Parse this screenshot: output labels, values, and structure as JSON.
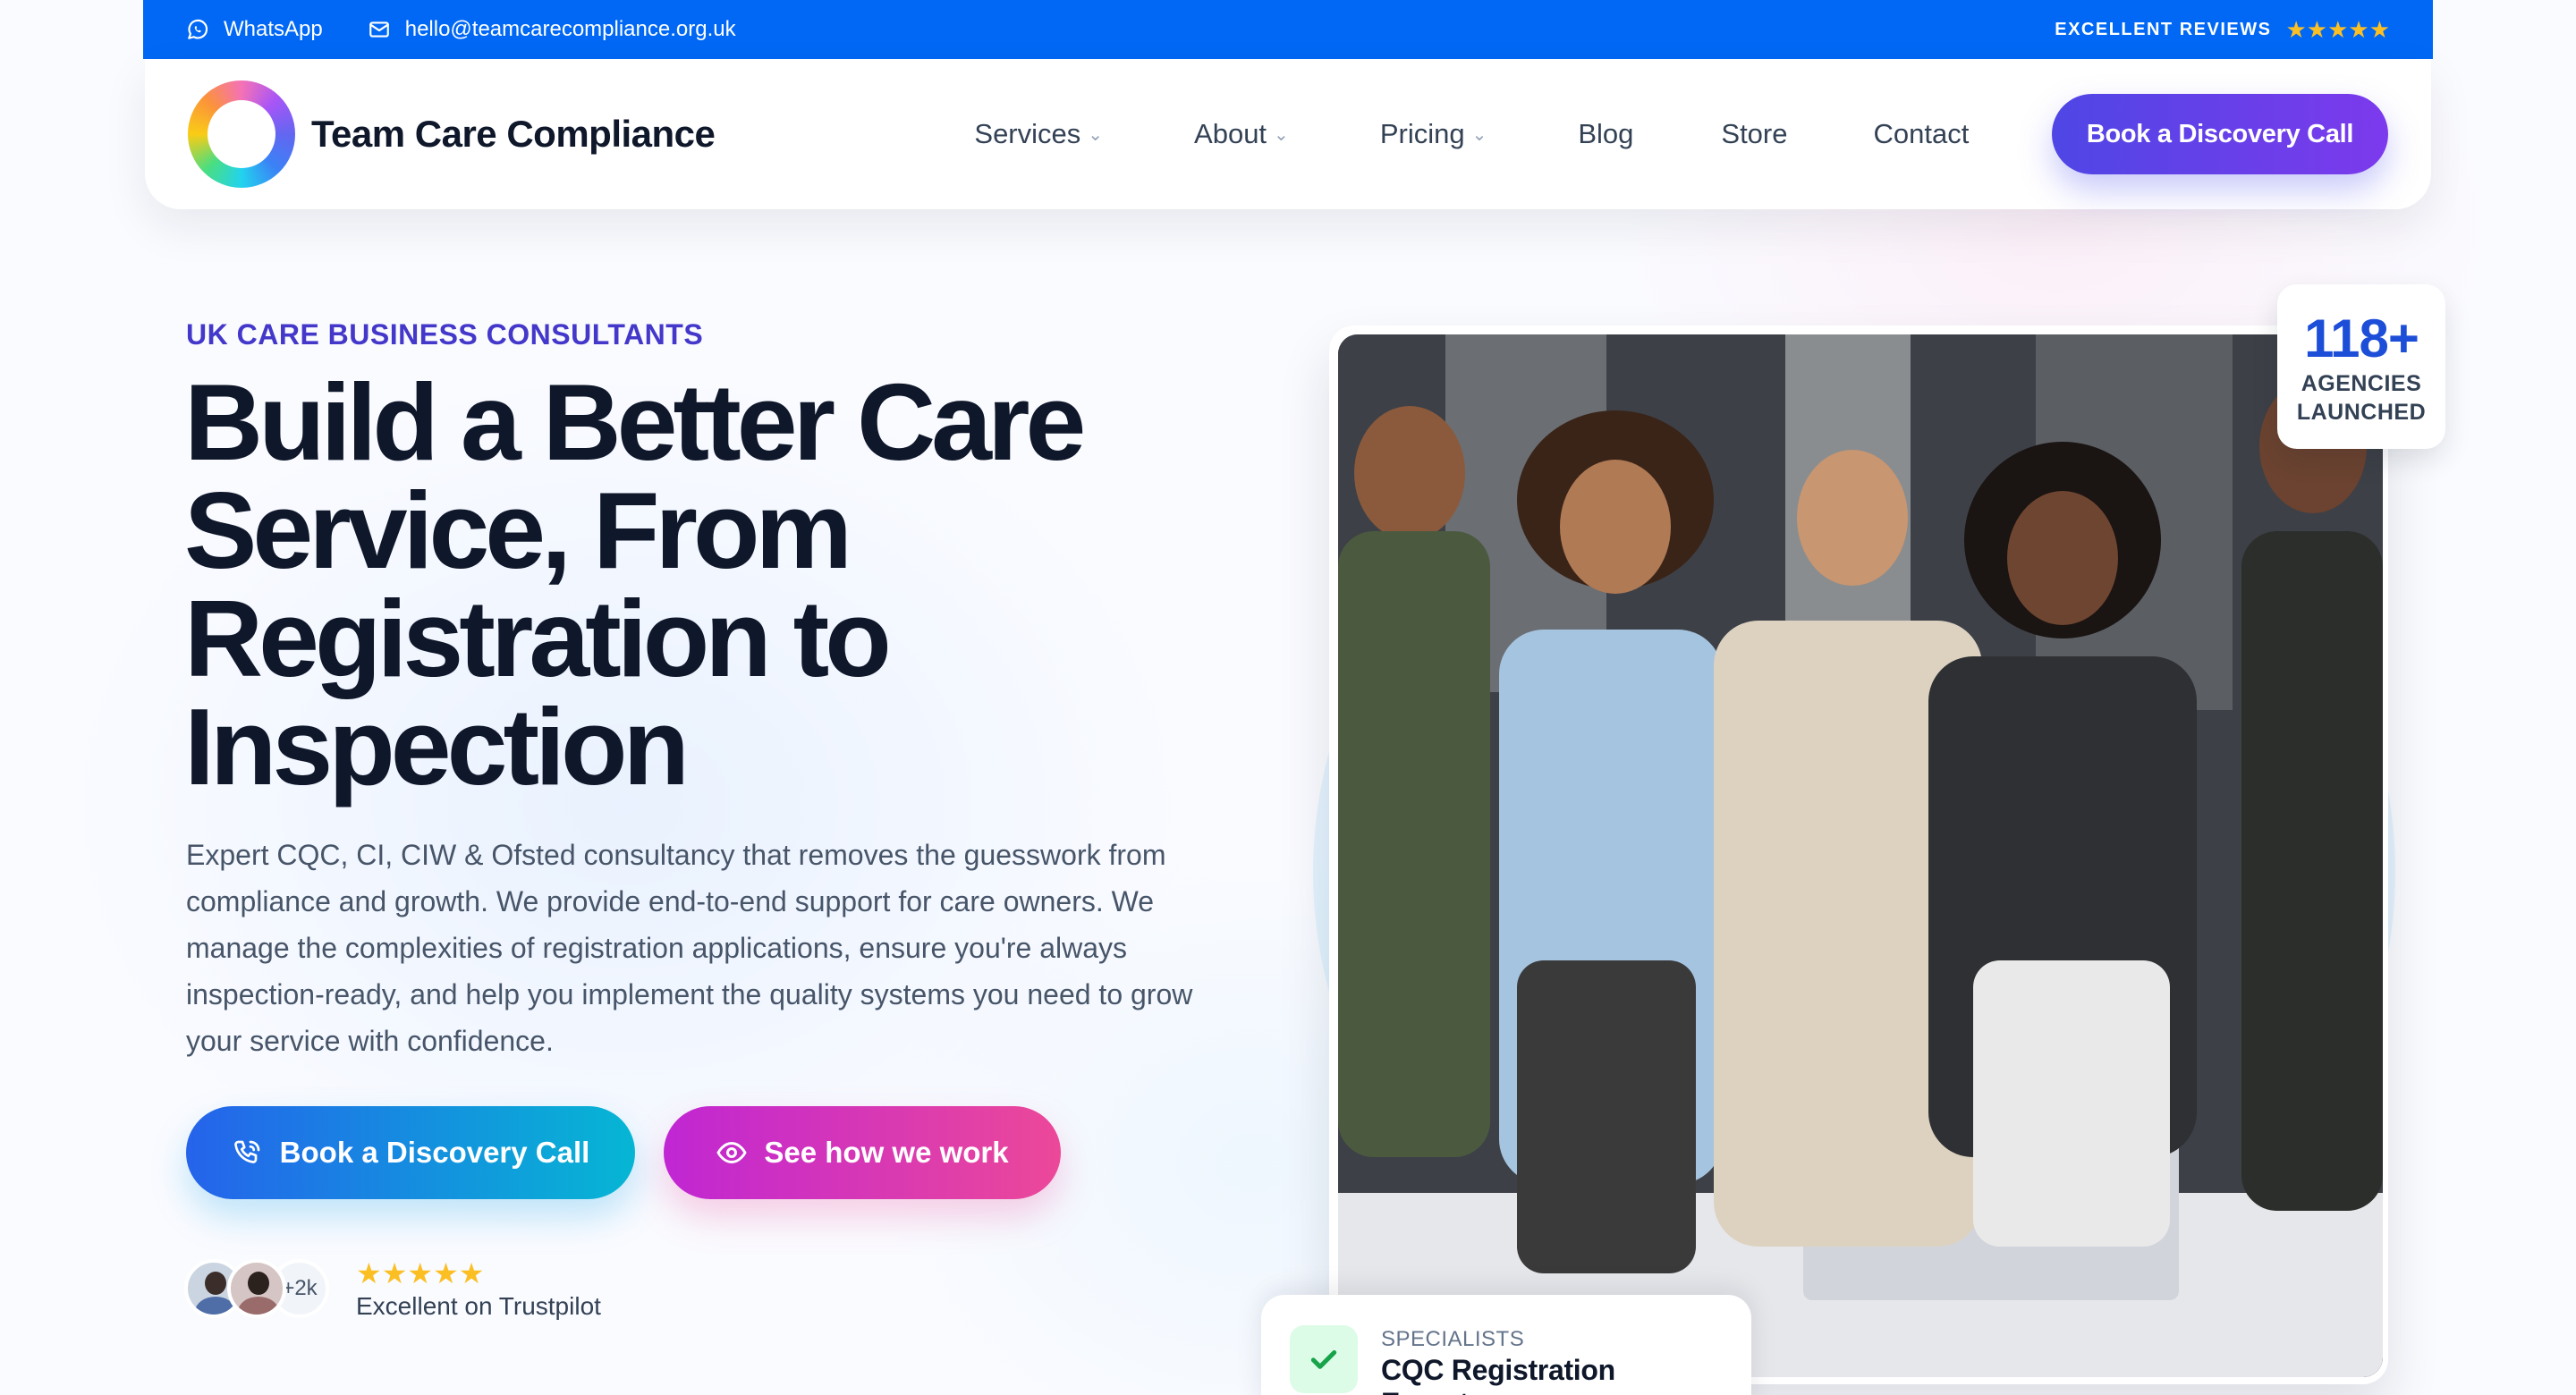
{
  "topbar": {
    "whatsapp_label": "WhatsApp",
    "email_label": "hello@teamcarecompliance.org.uk",
    "reviews_label": "EXCELLENT REVIEWS",
    "reviews_stars": "★★★★★",
    "icons": [
      "whatsapp-icon",
      "mail-icon",
      "star-icon"
    ],
    "background_color": "#0068f5"
  },
  "nav": {
    "brand_name": "Team Care Compliance",
    "items": [
      {
        "label": "Services",
        "has_dropdown": true
      },
      {
        "label": "About",
        "has_dropdown": true
      },
      {
        "label": "Pricing",
        "has_dropdown": true
      },
      {
        "label": "Blog",
        "has_dropdown": false
      },
      {
        "label": "Store",
        "has_dropdown": false
      },
      {
        "label": "Contact",
        "has_dropdown": false
      }
    ],
    "dropdown_glyph": "⌄",
    "cta_label": "Book a Discovery Call"
  },
  "hero": {
    "eyebrow": "UK CARE BUSINESS CONSULTANTS",
    "headline_lines": [
      "Build a Better Care",
      "Service, From",
      "Registration to",
      "Inspection"
    ],
    "subcopy": "Expert CQC, CI, CIW & Ofsted consultancy that removes the guesswork from compliance and growth. We provide end-to-end support for care owners. We manage the complexities of registration applications, ensure you're always inspection-ready, and help you implement the quality systems you need to grow your service with confidence.",
    "primary_button": "Book a Discovery Call",
    "secondary_button": "See how we work",
    "social_proof": {
      "avatar_count": "+2k",
      "stars": "★★★★★",
      "rating_text": "Excellent on Trustpilot"
    }
  },
  "stat_badge": {
    "number": "118+",
    "label_line1": "AGENCIES",
    "label_line2": "LAUNCHED"
  },
  "spec_card": {
    "eyebrow": "SPECIALISTS",
    "title": "CQC Registration Experts"
  },
  "colors": {
    "accent_indigo": "#4338ca",
    "headline": "#0f172a",
    "primary_gradient": [
      "#2563eb",
      "#06b6d4"
    ],
    "secondary_gradient": [
      "#c026d3",
      "#ec4899"
    ],
    "star": "#fbbf24"
  }
}
